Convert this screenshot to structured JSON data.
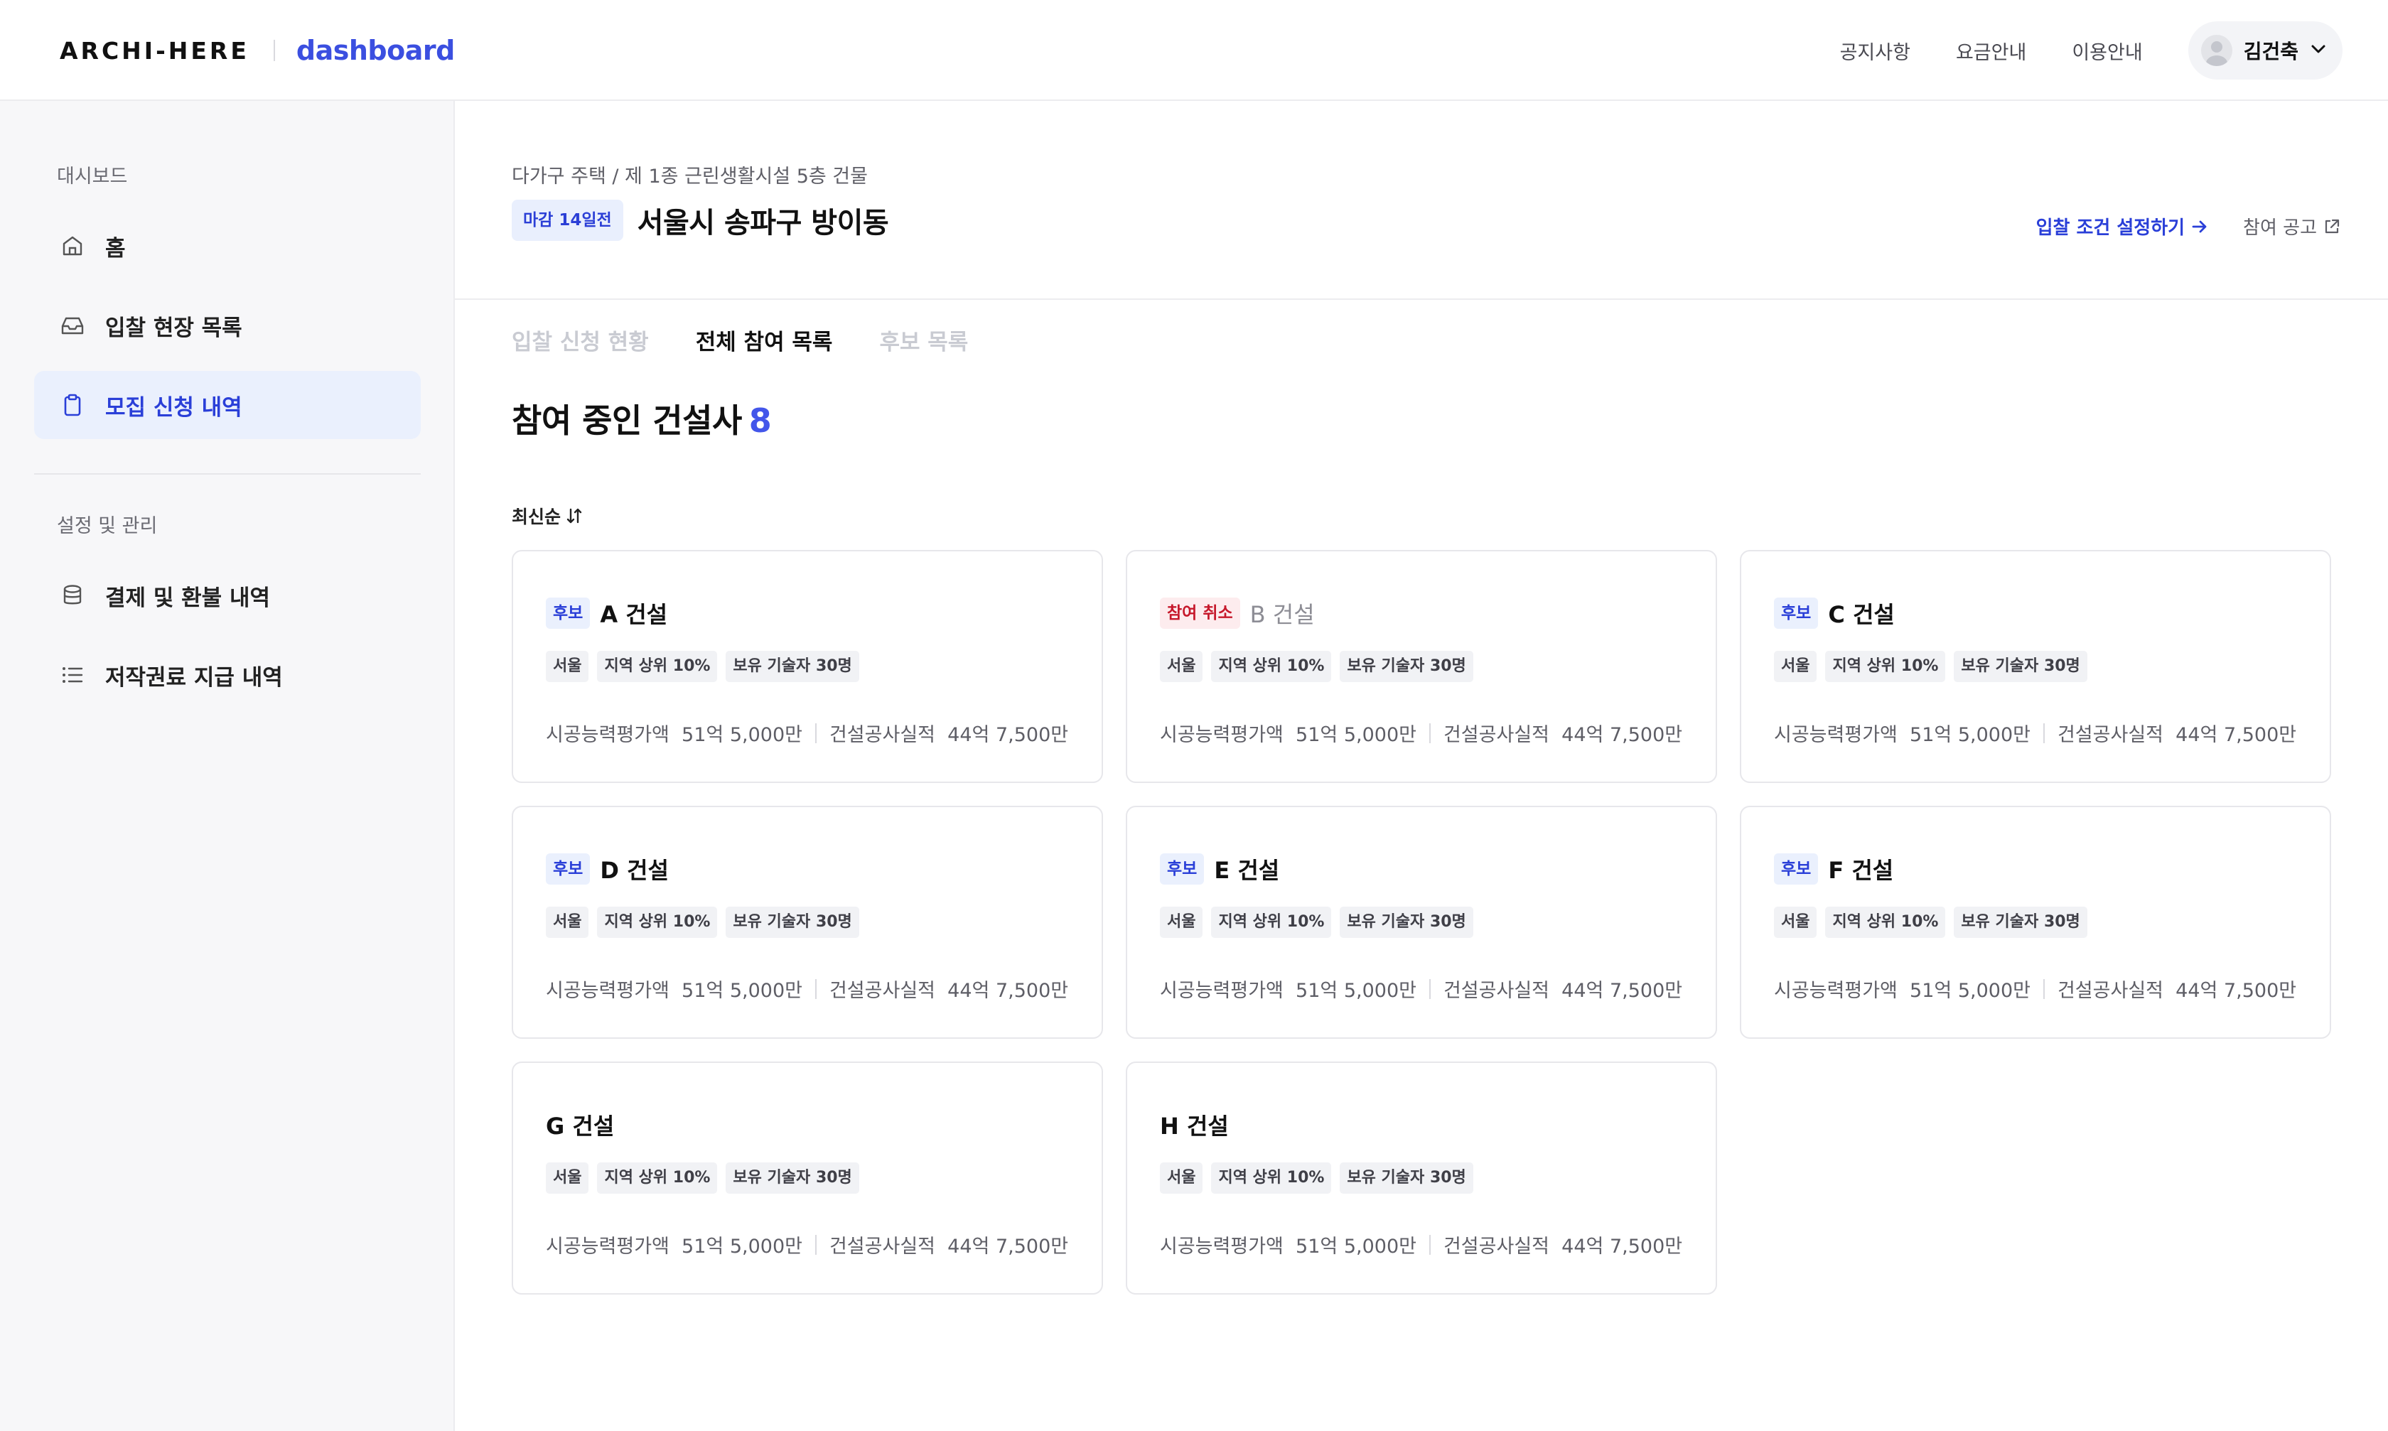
{
  "header": {
    "logo": "ARCHI-HERE",
    "product": "dashboard",
    "nav": [
      "공지사항",
      "요금안내",
      "이용안내"
    ],
    "user_name": "김건축"
  },
  "sidebar": {
    "section1": "대시보드",
    "items1": [
      {
        "label": "홈",
        "icon": "home-icon"
      },
      {
        "label": "입찰 현장 목록",
        "icon": "inbox-icon"
      },
      {
        "label": "모집 신청 내역",
        "icon": "clipboard-icon",
        "active": true
      }
    ],
    "section2": "설정 및 관리",
    "items2": [
      {
        "label": "결제 및 환불 내역",
        "icon": "database-icon"
      },
      {
        "label": "저작권료 지급 내역",
        "icon": "list-icon"
      }
    ]
  },
  "project": {
    "subtitle": "다가구 주택 / 제 1종 근린생활시설 5층 건물",
    "deadline_badge": "마감 14일전",
    "title": "서울시 송파구 방이동",
    "action_primary": "입찰 조건 설정하기",
    "action_secondary": "참여 공고"
  },
  "tabs": [
    "입찰 신청 현황",
    "전체 참여 목록",
    "후보 목록"
  ],
  "section": {
    "title": "참여 중인 건설사",
    "count": "8"
  },
  "sort_label": "최신순",
  "colors": {
    "accent": "#3b4fe0",
    "cancel": "#c6182b"
  },
  "cards": [
    {
      "status": "후보",
      "name": "A 건설",
      "tags": [
        "서울",
        "지역 상위 10%",
        "보유 기술자 30명"
      ],
      "metric1": "시공능력평가액  51억 5,000만",
      "metric2": "건설공사실적  44억 7,500만"
    },
    {
      "status": "참여 취소",
      "name": "B 건설",
      "tags": [
        "서울",
        "지역 상위 10%",
        "보유 기술자 30명"
      ],
      "metric1": "시공능력평가액  51억 5,000만",
      "metric2": "건설공사실적  44억 7,500만"
    },
    {
      "status": "후보",
      "name": "C 건설",
      "tags": [
        "서울",
        "지역 상위 10%",
        "보유 기술자 30명"
      ],
      "metric1": "시공능력평가액  51억 5,000만",
      "metric2": "건설공사실적  44억 7,500만"
    },
    {
      "status": "후보",
      "name": "D 건설",
      "tags": [
        "서울",
        "지역 상위 10%",
        "보유 기술자 30명"
      ],
      "metric1": "시공능력평가액  51억 5,000만",
      "metric2": "건설공사실적  44억 7,500만"
    },
    {
      "status": "후보",
      "name": "E 건설",
      "tags": [
        "서울",
        "지역 상위 10%",
        "보유 기술자 30명"
      ],
      "metric1": "시공능력평가액  51억 5,000만",
      "metric2": "건설공사실적  44억 7,500만"
    },
    {
      "status": "후보",
      "name": "F 건설",
      "tags": [
        "서울",
        "지역 상위 10%",
        "보유 기술자 30명"
      ],
      "metric1": "시공능력평가액  51억 5,000만",
      "metric2": "건설공사실적  44억 7,500만"
    },
    {
      "status": "",
      "name": "G 건설",
      "tags": [
        "서울",
        "지역 상위 10%",
        "보유 기술자 30명"
      ],
      "metric1": "시공능력평가액  51억 5,000만",
      "metric2": "건설공사실적  44억 7,500만"
    },
    {
      "status": "",
      "name": "H 건설",
      "tags": [
        "서울",
        "지역 상위 10%",
        "보유 기술자 30명"
      ],
      "metric1": "시공능력평가액  51억 5,000만",
      "metric2": "건설공사실적  44억 7,500만"
    }
  ]
}
